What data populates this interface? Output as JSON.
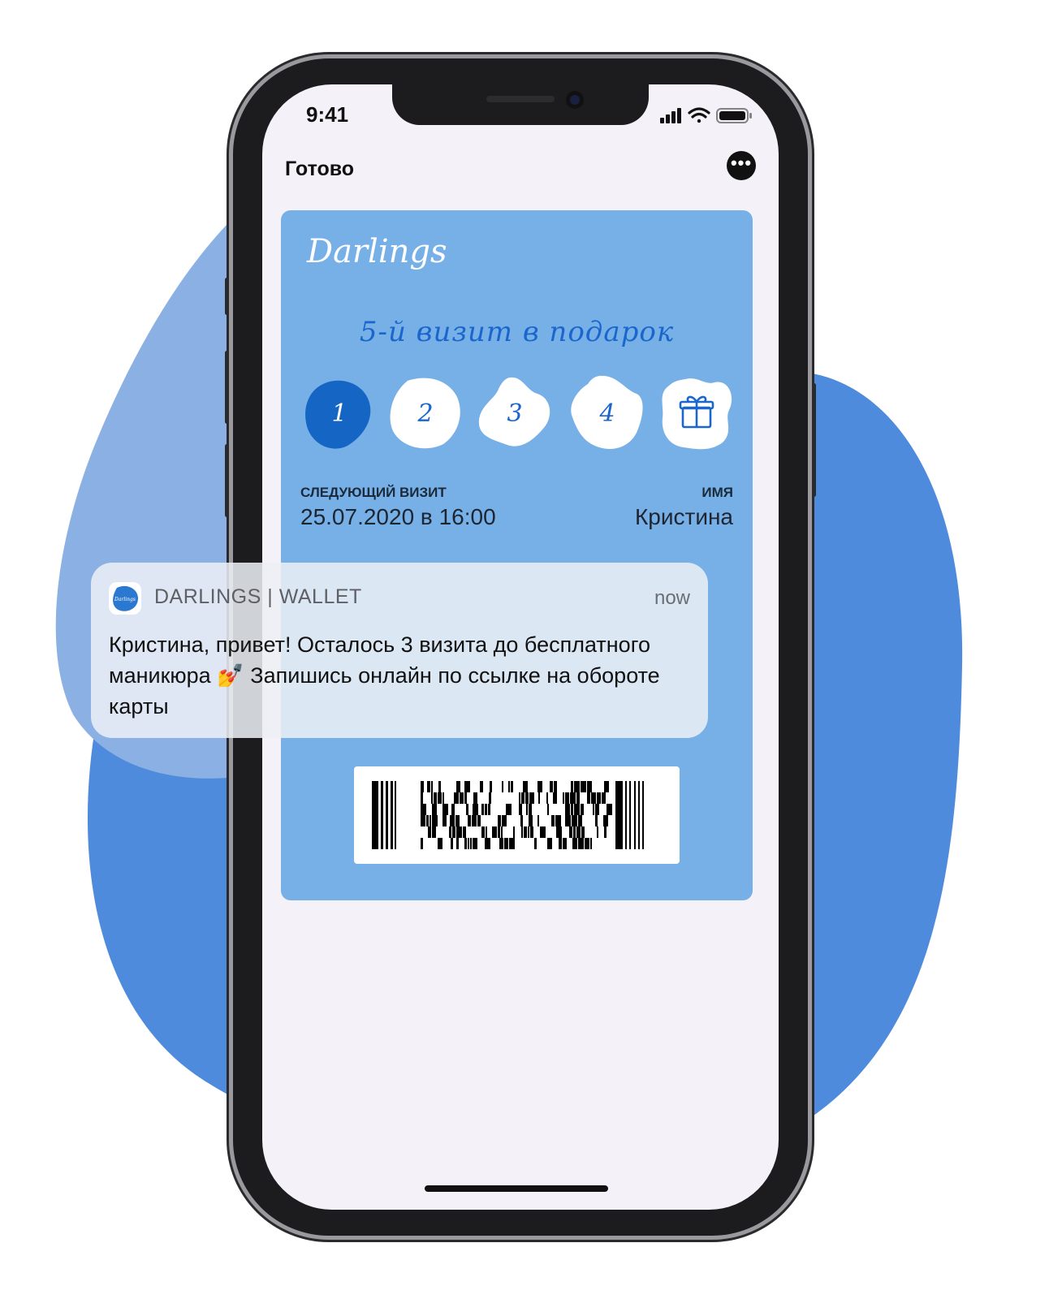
{
  "status_bar": {
    "time": "9:41"
  },
  "nav": {
    "done_label": "Готово",
    "more_icon": "ellipsis-circle-icon"
  },
  "card": {
    "brand": "Darlings",
    "promo": "5-й визит в подарок",
    "stamps": [
      {
        "label": "1",
        "filled": true
      },
      {
        "label": "2",
        "filled": false
      },
      {
        "label": "3",
        "filled": false
      },
      {
        "label": "4",
        "filled": false
      },
      {
        "label": "",
        "icon": "gift-icon",
        "filled": false
      }
    ],
    "next_visit_label": "следующий визит",
    "next_visit_value": "25.07.2020 в 16:00",
    "name_label": "имя",
    "name_value": "Кристина",
    "background_color": "#76b0e6",
    "accent_color": "#1a66cc"
  },
  "notification": {
    "app_name": "DARLINGS | WALLET",
    "time": "now",
    "message": "Кристина, привет! Осталось 3 визита до бесплатного маникюра 💅 Запишись онлайн по ссылке на обороте карты"
  },
  "colors": {
    "blob_dark": "#4f8bdc",
    "blob_light": "#8ab0e4"
  }
}
